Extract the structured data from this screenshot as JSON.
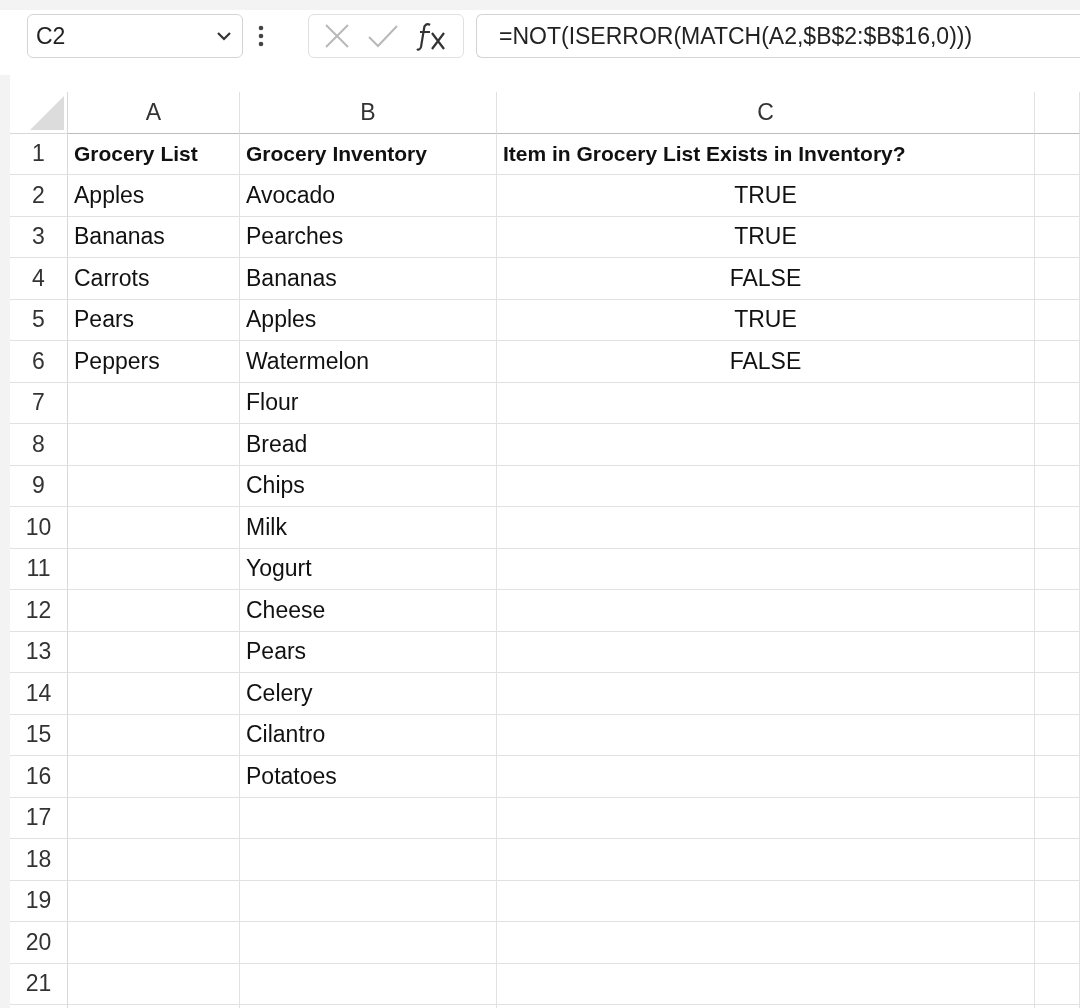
{
  "formula_bar": {
    "name_box": "C2",
    "formula": "=NOT(ISERROR(MATCH(A2,$B$2:$B$16,0)))"
  },
  "sheet": {
    "columns": [
      "A",
      "B",
      "C"
    ],
    "header_row": {
      "number": "1",
      "cells": [
        "Grocery List",
        "Grocery Inventory",
        "Item in Grocery List Exists in Inventory?"
      ]
    },
    "rows": [
      {
        "number": "2",
        "cells": [
          "Apples",
          "Avocado",
          "TRUE"
        ]
      },
      {
        "number": "3",
        "cells": [
          "Bananas",
          "Pearches",
          "TRUE"
        ]
      },
      {
        "number": "4",
        "cells": [
          "Carrots",
          "Bananas",
          "FALSE"
        ]
      },
      {
        "number": "5",
        "cells": [
          "Pears",
          "Apples",
          "TRUE"
        ]
      },
      {
        "number": "6",
        "cells": [
          "Peppers",
          "Watermelon",
          "FALSE"
        ]
      },
      {
        "number": "7",
        "cells": [
          "",
          "Flour",
          ""
        ]
      },
      {
        "number": "8",
        "cells": [
          "",
          "Bread",
          ""
        ]
      },
      {
        "number": "9",
        "cells": [
          "",
          "Chips",
          ""
        ]
      },
      {
        "number": "10",
        "cells": [
          "",
          "Milk",
          ""
        ]
      },
      {
        "number": "11",
        "cells": [
          "",
          "Yogurt",
          ""
        ]
      },
      {
        "number": "12",
        "cells": [
          "",
          "Cheese",
          ""
        ]
      },
      {
        "number": "13",
        "cells": [
          "",
          "Pears",
          ""
        ]
      },
      {
        "number": "14",
        "cells": [
          "",
          "Celery",
          ""
        ]
      },
      {
        "number": "15",
        "cells": [
          "",
          "Cilantro",
          ""
        ]
      },
      {
        "number": "16",
        "cells": [
          "",
          "Potatoes",
          ""
        ]
      },
      {
        "number": "17",
        "cells": [
          "",
          "",
          ""
        ]
      },
      {
        "number": "18",
        "cells": [
          "",
          "",
          ""
        ]
      },
      {
        "number": "19",
        "cells": [
          "",
          "",
          ""
        ]
      },
      {
        "number": "20",
        "cells": [
          "",
          "",
          ""
        ]
      },
      {
        "number": "21",
        "cells": [
          "",
          "",
          ""
        ]
      }
    ]
  }
}
